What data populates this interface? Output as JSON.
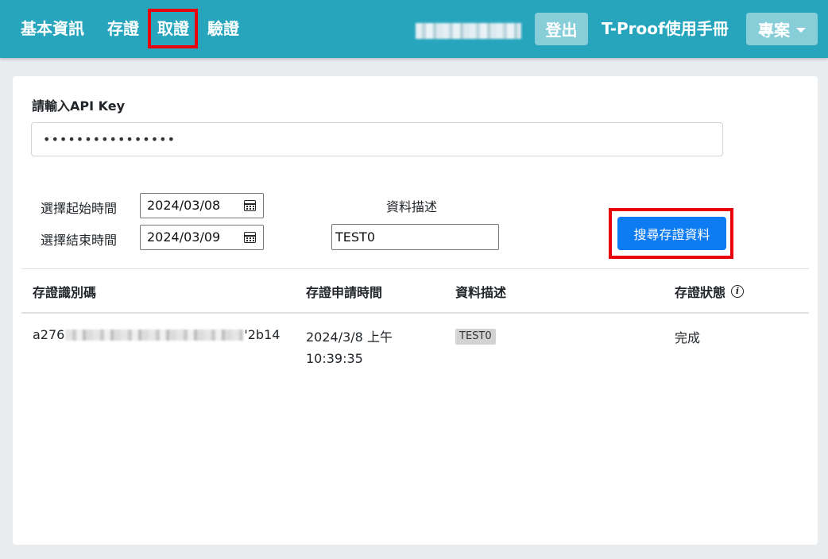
{
  "nav": {
    "basic_info": "基本資訊",
    "store": "存證",
    "retrieve": "取證",
    "verify": "驗證",
    "logout": "登出",
    "manual": "T-Proof使用手冊",
    "project": "專案"
  },
  "form": {
    "api_key_label": "請輸入API Key",
    "api_key_value": "••••••••••••••••",
    "start_label": "選擇起始時間",
    "start_value": "2024/03/08",
    "end_label": "選擇結束時間",
    "end_value": "2024/03/09",
    "desc_label": "資料描述",
    "desc_value": "TEST0",
    "search_button": "搜尋存證資料"
  },
  "table": {
    "headers": {
      "id": "存證識別碼",
      "time": "存證申請時間",
      "desc": "資料描述",
      "status": "存證狀態"
    },
    "rows": [
      {
        "id_prefix": "a276",
        "id_suffix": "'2b14",
        "time_date": "2024/3/8 上午",
        "time_clock": "10:39:35",
        "desc": "TEST0",
        "status": "完成"
      }
    ]
  },
  "icons": {
    "date_picker": "calendar-icon",
    "status_info": "info-icon",
    "project_dropdown": "caret-down-icon"
  },
  "colors": {
    "navbar": "#27a5bd",
    "nav_button": "#87ced9",
    "primary_button": "#0d7bf2",
    "highlight_box": "#e8000b",
    "page_background": "#e9ecef"
  }
}
